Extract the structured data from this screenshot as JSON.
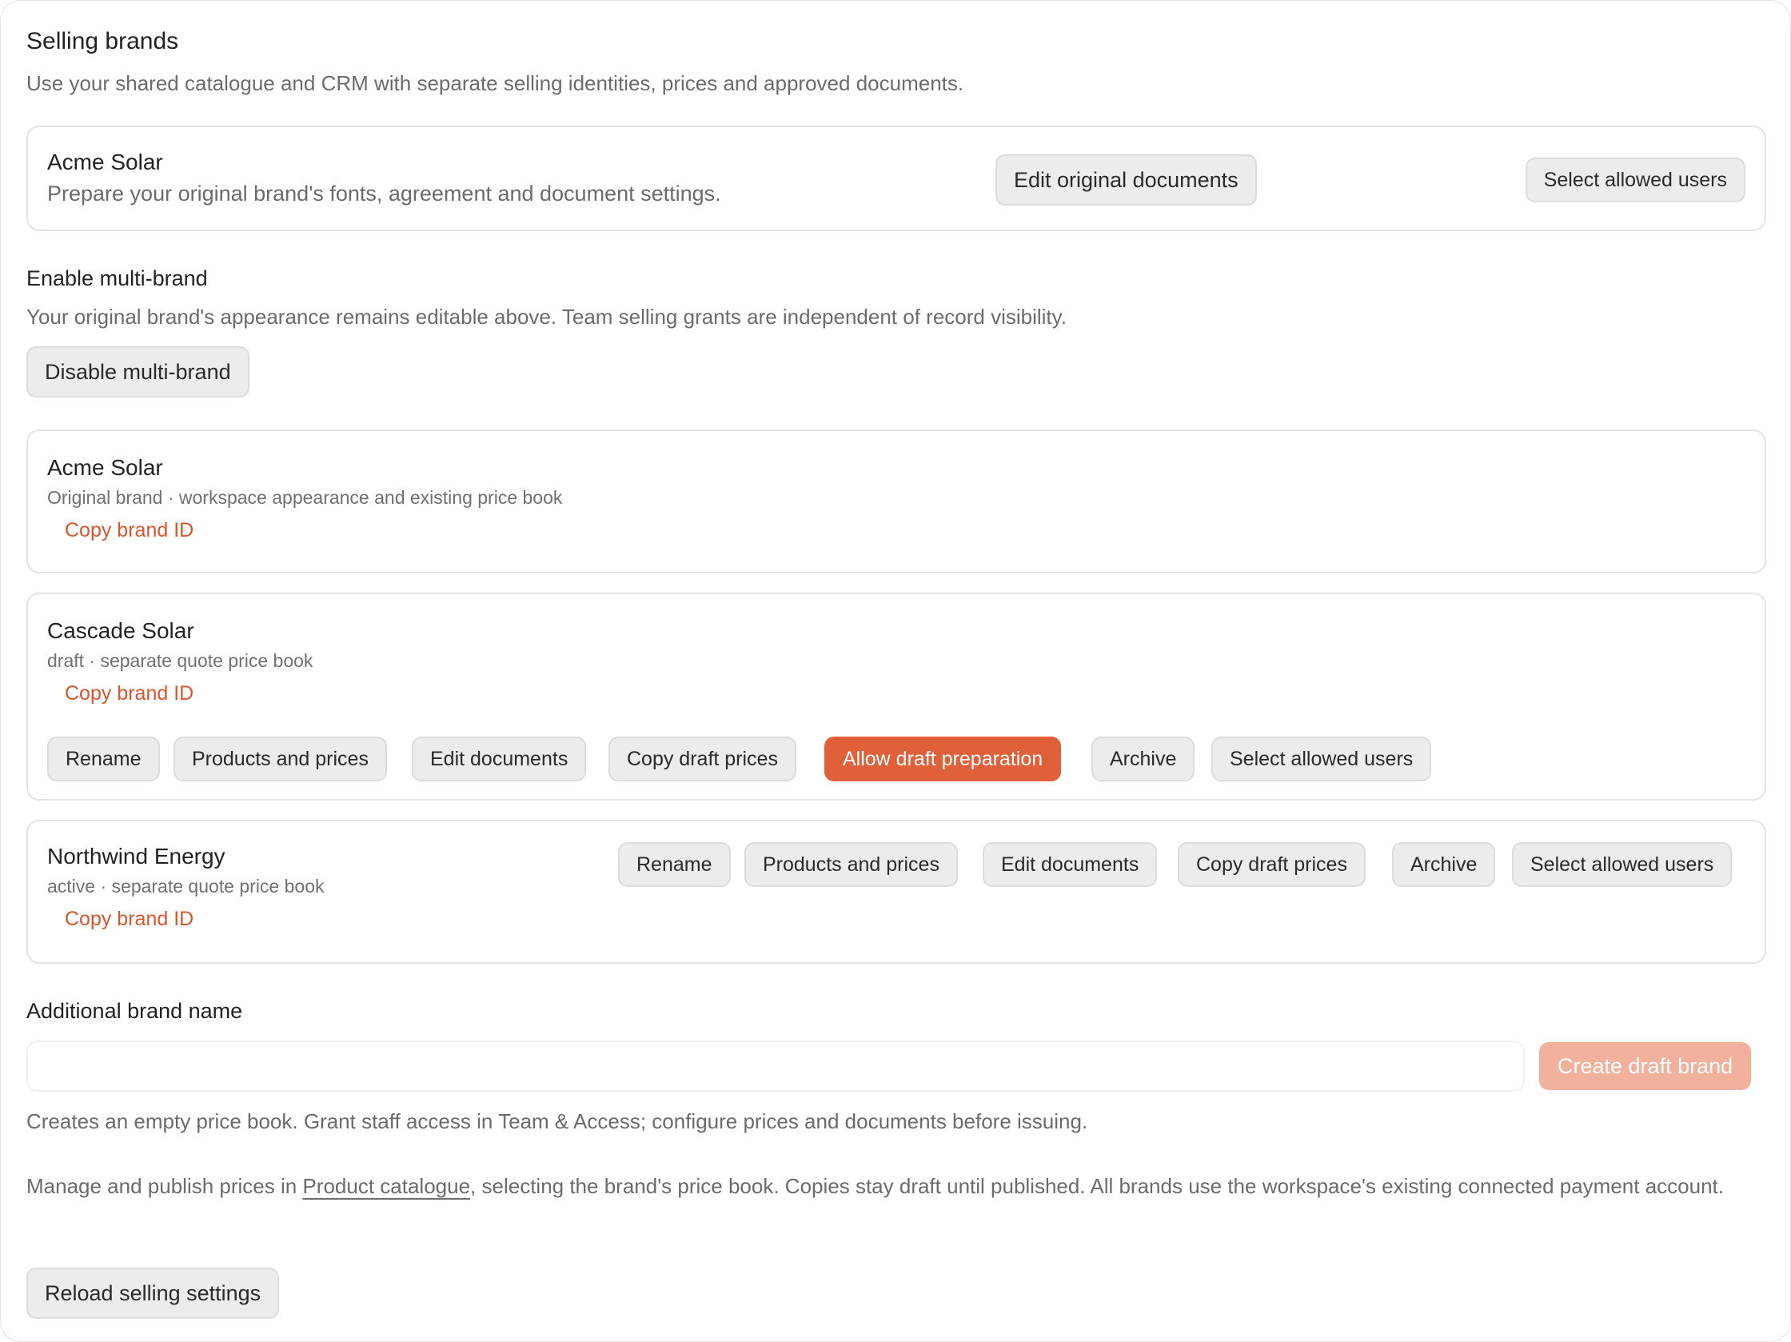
{
  "header": {
    "title": "Selling brands",
    "subtitle": "Use your shared catalogue and CRM with separate selling identities, prices and approved documents."
  },
  "original_card": {
    "name": "Acme Solar",
    "description": "Prepare your original brand's fonts, agreement and document settings.",
    "edit_button": "Edit original documents",
    "users_button": "Select allowed users"
  },
  "multi_brand": {
    "label": "Enable multi-brand",
    "help": "Your original brand's appearance remains editable above. Team selling grants are independent of record visibility.",
    "disable_button": "Disable multi-brand"
  },
  "brands": [
    {
      "name": "Acme Solar",
      "meta": "Original brand · workspace appearance and existing price book",
      "copy_id": "Copy brand ID"
    },
    {
      "name": "Cascade Solar",
      "meta": "draft · separate quote price book",
      "copy_id": "Copy brand ID",
      "actions": {
        "rename": "Rename",
        "products": "Products and prices",
        "edit_docs": "Edit documents",
        "copy_prices": "Copy draft prices",
        "allow_draft": "Allow draft preparation",
        "archive": "Archive",
        "users": "Select allowed users"
      }
    },
    {
      "name": "Northwind Energy",
      "meta": "active · separate quote price book",
      "copy_id": "Copy brand ID",
      "actions": {
        "rename": "Rename",
        "products": "Products and prices",
        "edit_docs": "Edit documents",
        "copy_prices": "Copy draft prices",
        "archive": "Archive",
        "users": "Select allowed users"
      }
    }
  ],
  "additional": {
    "label": "Additional brand name",
    "input_value": "",
    "input_placeholder": "",
    "create_button": "Create draft brand",
    "help": "Creates an empty price book. Grant staff access in Team & Access; configure prices and documents before issuing."
  },
  "footer": {
    "manage_before": "Manage and publish prices in ",
    "manage_link": "Product catalogue",
    "manage_after": ", selecting the brand's price book. Copies stay draft until published. All brands use the workspace's existing connected payment account.",
    "reload_button": "Reload selling settings"
  },
  "colors": {
    "accent": "#e0603a",
    "accent_disabled": "#f2b19d",
    "link": "#d9552f",
    "muted_text": "#6b6b6b"
  }
}
